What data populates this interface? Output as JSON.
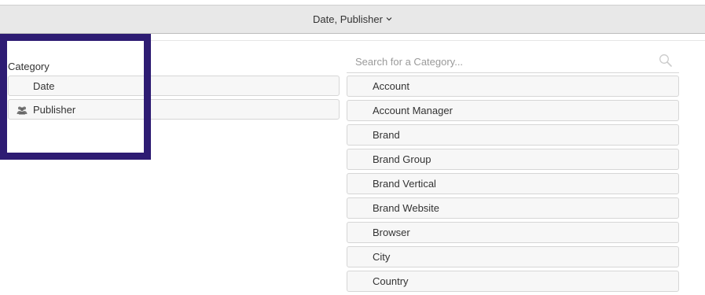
{
  "header": {
    "title": "Date, Publisher",
    "chevron_icon": "chevron-down-icon"
  },
  "selected": {
    "label": "Category",
    "items": [
      {
        "label": "Date",
        "icon": ""
      },
      {
        "label": "Publisher",
        "icon": "users-icon"
      }
    ]
  },
  "search": {
    "placeholder": "Search for a Category...",
    "value": "",
    "icon": "search-icon"
  },
  "available": {
    "items": [
      "Account",
      "Account Manager",
      "Brand",
      "Brand Group",
      "Brand Vertical",
      "Brand Website",
      "Browser",
      "City",
      "Country"
    ]
  },
  "colors": {
    "highlight_border": "#2e1c73",
    "header_bg": "#e8e8e8",
    "item_bg": "#f7f7f7"
  }
}
